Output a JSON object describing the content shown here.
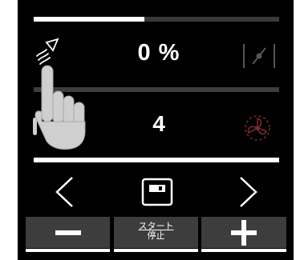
{
  "status": {
    "progress_fraction": 0.45
  },
  "rows": {
    "top": {
      "value": "0 %",
      "left_icon": "spray-icon",
      "right_icon": "damper-icon"
    },
    "bottom": {
      "value": "4",
      "right_icon": "fan-icon"
    }
  },
  "nav": {
    "prev_icon": "chevron-left-icon",
    "save_icon": "floppy-disk-icon",
    "next_icon": "chevron-right-icon"
  },
  "actions": {
    "minus_icon": "minus-icon",
    "start_label": "スタート",
    "stop_label": "停止",
    "plus_icon": "plus-icon"
  },
  "overlay": {
    "pointer_icon": "hand-pointer-icon"
  },
  "colors": {
    "background": "#000000",
    "foreground": "#ffffff",
    "button": "#3d3d3d",
    "muted_icon": "#555555",
    "divider": "#3d3d3d"
  }
}
